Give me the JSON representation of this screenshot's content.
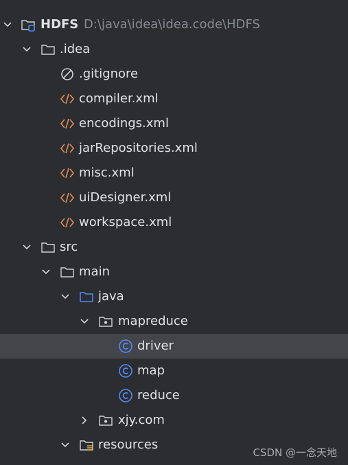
{
  "project_tree": {
    "root": {
      "label": "HDFS",
      "path": "D:\\java\\idea\\idea.code\\HDFS",
      "icon": "project-folder-icon",
      "expanded": true
    },
    "idea_folder": {
      "label": ".idea",
      "icon": "folder-icon",
      "expanded": true
    },
    "idea_files": [
      {
        "label": ".gitignore",
        "icon": "ignore-file-icon"
      },
      {
        "label": "compiler.xml",
        "icon": "xml-file-icon"
      },
      {
        "label": "encodings.xml",
        "icon": "xml-file-icon"
      },
      {
        "label": "jarRepositories.xml",
        "icon": "xml-file-icon"
      },
      {
        "label": "misc.xml",
        "icon": "xml-file-icon"
      },
      {
        "label": "uiDesigner.xml",
        "icon": "xml-file-icon"
      },
      {
        "label": "workspace.xml",
        "icon": "xml-file-icon"
      }
    ],
    "src_folder": {
      "label": "src",
      "icon": "folder-icon",
      "expanded": true
    },
    "main_folder": {
      "label": "main",
      "icon": "folder-icon",
      "expanded": true
    },
    "java_folder": {
      "label": "java",
      "icon": "source-root-folder-icon",
      "expanded": true
    },
    "mapreduce_package": {
      "label": "mapreduce",
      "icon": "package-icon",
      "expanded": true
    },
    "classes": [
      {
        "label": "driver",
        "icon": "class-icon",
        "selected": true
      },
      {
        "label": "map",
        "icon": "class-icon",
        "selected": false
      },
      {
        "label": "reduce",
        "icon": "class-icon",
        "selected": false
      }
    ],
    "xjy_package": {
      "label": "xjy.com",
      "icon": "package-icon",
      "expanded": false
    },
    "resources_folder": {
      "label": "resources",
      "icon": "resources-folder-icon",
      "expanded": true
    }
  },
  "watermark": "CSDN @一念天地",
  "colors": {
    "background": "#2b2d30",
    "selection": "#43454a",
    "text": "#dfe1e5",
    "path_text": "#868a91",
    "xml_icon": "#e08855",
    "class_icon": "#548af7",
    "source_folder_icon": "#548af7"
  }
}
